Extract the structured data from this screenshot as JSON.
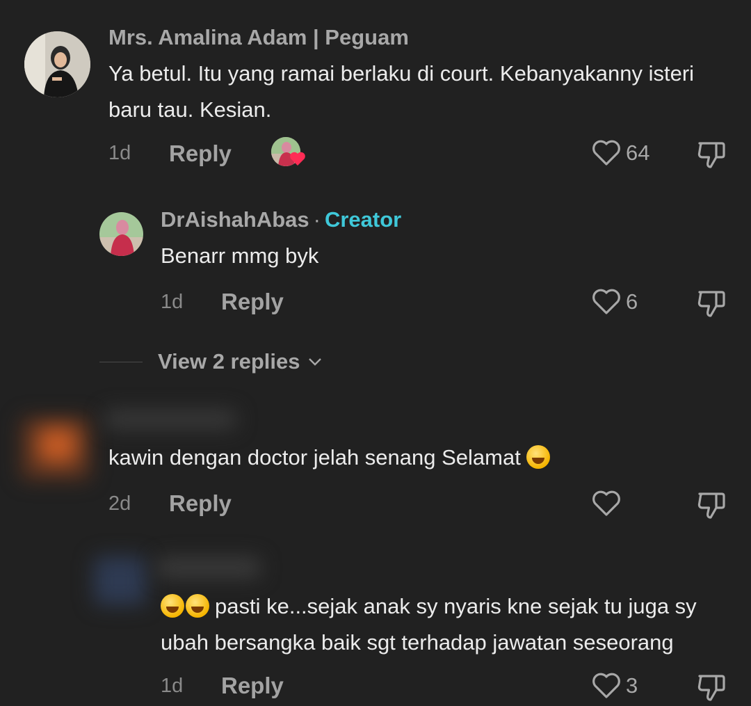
{
  "comments": [
    {
      "username": "Mrs. Amalina Adam | Peguam",
      "text": "Ya betul. Itu yang ramai berlaku di court. Kebanyakanny isteri baru tau. Kesian.",
      "time": "1d",
      "reply_label": "Reply",
      "likes": "64",
      "avatar_icon": "user-avatar-photo"
    },
    {
      "username": "DrAishahAbas",
      "separator": "·",
      "badge": "Creator",
      "text": "Benarr mmg byk",
      "time": "1d",
      "reply_label": "Reply",
      "likes": "6"
    },
    {
      "text": "kawin dengan doctor jelah senang Selamat",
      "time": "2d",
      "reply_label": "Reply"
    },
    {
      "text": "pasti ke...sejak anak sy nyaris kne sejak tu juga sy ubah bersangka baik sgt terhadap jawatan seseorang",
      "time": "1d",
      "reply_label": "Reply",
      "likes": "3"
    }
  ],
  "view_replies": {
    "label": "View 2 replies"
  },
  "colors": {
    "background": "#212121",
    "username": "#a8a8a8",
    "text": "#ececec",
    "creator": "#3fc8d9",
    "liked_heart": "#fe2c55"
  }
}
